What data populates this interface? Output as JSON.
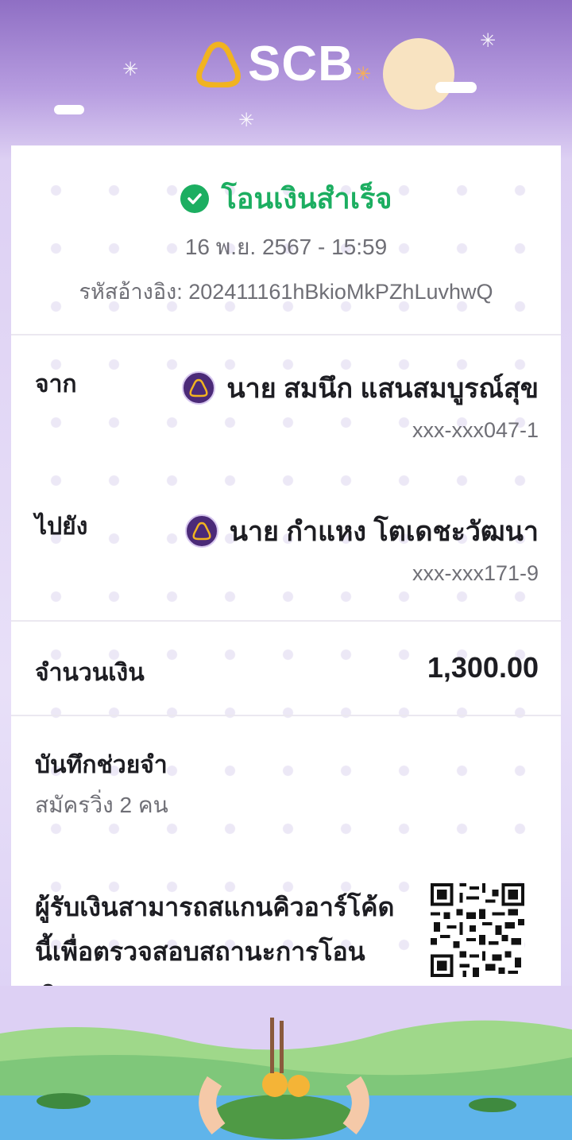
{
  "brand": {
    "name": "SCB"
  },
  "status": {
    "text": "โอนเงินสำเร็จ",
    "icon": "check-circle-icon",
    "color": "#1cae61"
  },
  "transaction": {
    "datetime": "16 พ.ย. 2567 - 15:59",
    "reference_label": "รหัสอ้างอิง:",
    "reference": "202411161hBkioMkPZhLuvhwQ"
  },
  "from": {
    "label": "จาก",
    "name": "นาย สมนึก แสนสมบูรณ์สุข",
    "account": "xxx-xxx047-1",
    "bank_icon": "scb-bank-icon"
  },
  "to": {
    "label": "ไปยัง",
    "name": "นาย กำแหง โตเดชะวัฒนา",
    "account": "xxx-xxx171-9",
    "bank_icon": "scb-bank-icon"
  },
  "amount": {
    "label": "จำนวนเงิน",
    "value": "1,300.00"
  },
  "memo": {
    "label": "บันทึกช่วยจำ",
    "value": "สมัครวิ่ง 2 คน"
  },
  "qr": {
    "text": "ผู้รับเงินสามารถสแกนคิวอาร์โค้ดนี้เพื่อตรวจสอบสถานะการโอนเงิน"
  },
  "colors": {
    "brand_purple": "#4b2a78",
    "success_green": "#1cae61",
    "logo_gold": "#f1b320"
  }
}
